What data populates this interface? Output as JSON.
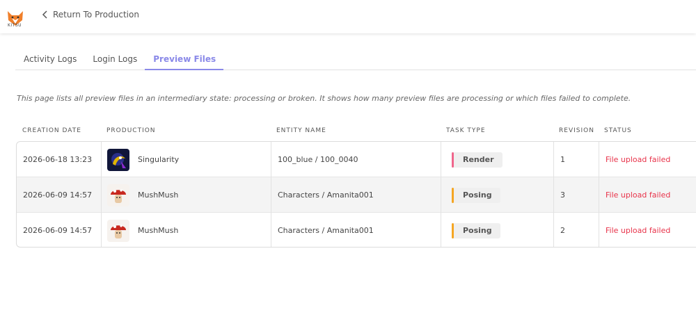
{
  "header": {
    "logo_text": "KITSU",
    "back_label": "Return To Production"
  },
  "tabs": [
    {
      "label": "Activity Logs"
    },
    {
      "label": "Login Logs"
    },
    {
      "label": "Preview Files"
    }
  ],
  "description": "This page lists all preview files in an intermediary state: processing or broken. It shows how many preview files are processing or which files failed to complete.",
  "table": {
    "columns": [
      "CREATION DATE",
      "PRODUCTION",
      "ENTITY NAME",
      "TASK TYPE",
      "REVISION",
      "STATUS"
    ],
    "rows": [
      {
        "date": "2026-06-18 13:23",
        "production": "Singularity",
        "entity": "100_blue / 100_0040",
        "task": "Render",
        "task_color": "#f0668c",
        "revision": "1",
        "status": "File upload failed",
        "thumb": "singularity-icon"
      },
      {
        "date": "2026-06-09 14:57",
        "production": "MushMush",
        "entity": "Characters / Amanita001",
        "task": "Posing",
        "task_color": "#f5a623",
        "revision": "3",
        "status": "File upload failed",
        "thumb": "mushroom-icon"
      },
      {
        "date": "2026-06-09 14:57",
        "production": "MushMush",
        "entity": "Characters / Amanita001",
        "task": "Posing",
        "task_color": "#f5a623",
        "revision": "2",
        "status": "File upload failed",
        "thumb": "mushroom-icon"
      }
    ]
  },
  "colors": {
    "accent": "#8a89e8",
    "error": "#e8334a"
  }
}
